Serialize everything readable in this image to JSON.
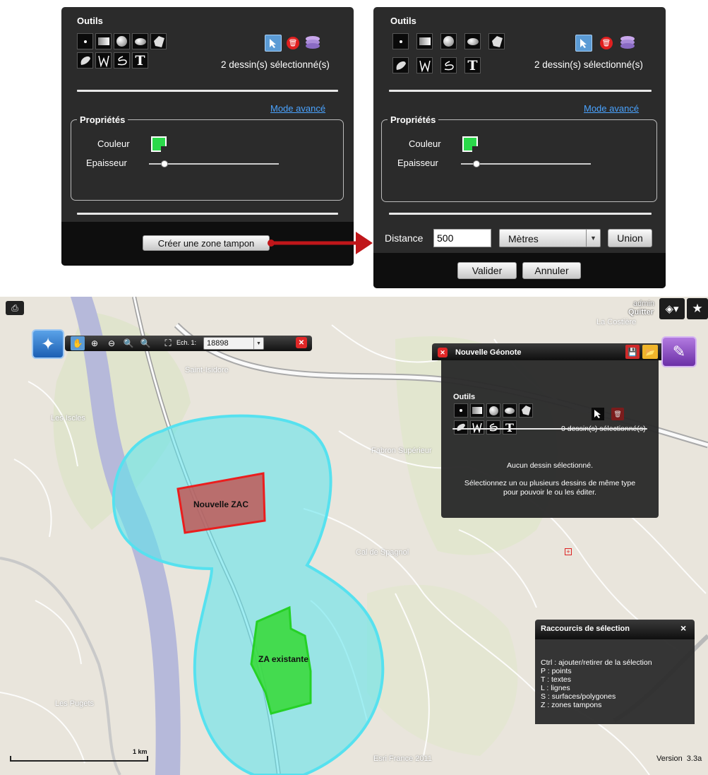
{
  "left_panel": {
    "tools_title": "Outils",
    "selection_count": "2 dessin(s) sélectionné(s)",
    "advanced_mode_link": "Mode avancé",
    "properties_legend": "Propriétés",
    "color_label": "Couleur",
    "thickness_label": "Epaisseur",
    "thickness_level": 0.12,
    "buffer_button": "Créer une zone tampon"
  },
  "right_panel": {
    "tools_title": "Outils",
    "selection_count": "2 dessin(s) sélectionné(s)",
    "advanced_mode_link": "Mode avancé",
    "properties_legend": "Propriétés",
    "color_label": "Couleur",
    "thickness_label": "Epaisseur",
    "thickness_level": 0.12,
    "distance_label": "Distance",
    "distance_value": "500",
    "unit_selected": "Mètres",
    "union_button": "Union",
    "validate_button": "Valider",
    "cancel_button": "Annuler"
  },
  "map": {
    "user_name": "admin",
    "logout": "Quitter",
    "scale_label": "Ech. 1:",
    "scale_value": "18898",
    "place_labels": [
      "Saint-Isidore",
      "Les Iscles",
      "Fabron Supérieur",
      "Cal de Spagnol",
      "Les Pugets",
      "La Costière"
    ],
    "zone_new": "Nouvelle ZAC",
    "zone_existing": "ZA existante",
    "scale_bar_label": "1 km",
    "attribution": "Esri France 2011",
    "version": "Version  3.3a",
    "colors": {
      "buffer": "#5fe3ec",
      "zone_new": "#c0504f",
      "zone_existing": "#35d935"
    }
  },
  "geonote": {
    "title": "Nouvelle Géonote",
    "tools_title": "Outils",
    "selection_count": "0 dessin(s) sélectionné(s)",
    "no_selection": "Aucun dessin sélectionné.",
    "hint": "Sélectionnez un ou plusieurs dessins de même type pour pouvoir le ou les éditer."
  },
  "shortcuts": {
    "title": "Raccourcis de sélection",
    "close": "×",
    "lines": [
      "Ctrl : ajouter/retirer de la sélection",
      "P : points",
      "T : textes",
      "L : lignes",
      "S : surfaces/polygones",
      "Z : zones tampons"
    ]
  }
}
